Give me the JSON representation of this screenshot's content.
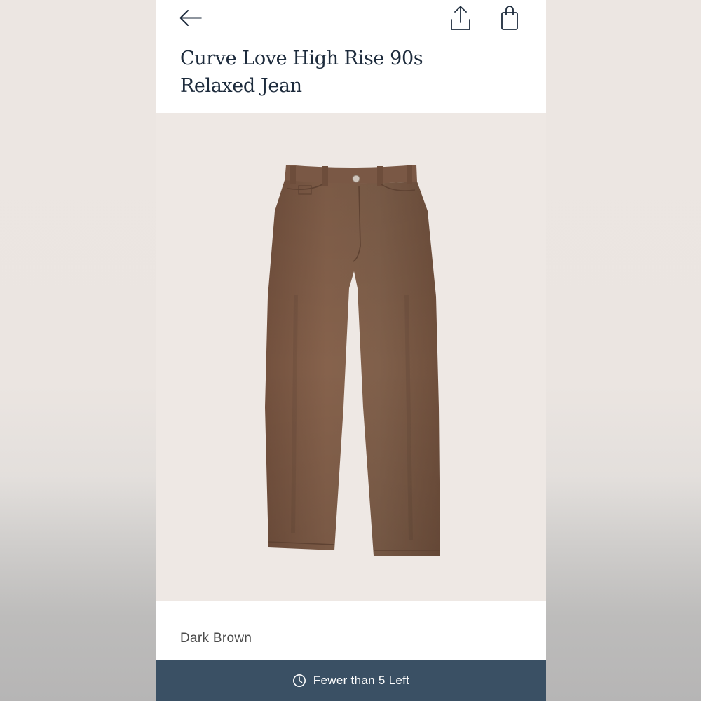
{
  "header": {
    "back_icon": "arrow-left-icon",
    "share_icon": "share-icon",
    "bag_icon": "shopping-bag-icon"
  },
  "product": {
    "title": "Curve Love High Rise 90s Relaxed Jean",
    "color": "Dark Brown",
    "image_subject": "brown-jeans-image"
  },
  "stock": {
    "icon": "clock-icon",
    "label": "Fewer than 5 Left"
  },
  "colors": {
    "title_text": "#1d2b3c",
    "stock_bar_bg": "#3a5064",
    "image_bg": "#eee8e4",
    "denim": "#7d5a46"
  }
}
